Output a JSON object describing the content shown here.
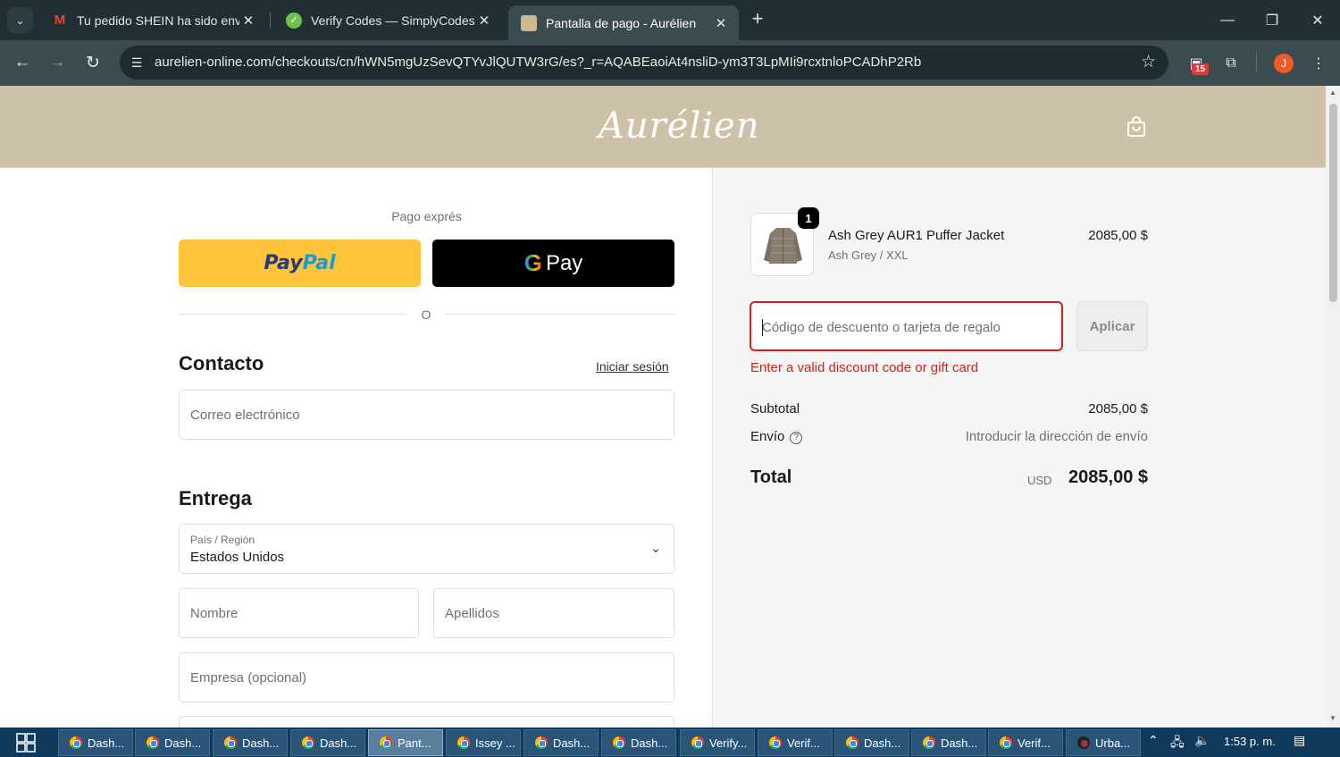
{
  "browser": {
    "tabs": [
      {
        "title": "Tu pedido SHEIN ha sido enviado",
        "icon": "gmail-icon"
      },
      {
        "title": "Verify Codes — SimplyCodes",
        "icon": "simplycodes-icon"
      },
      {
        "title": "Pantalla de pago - Aurélien",
        "icon": "aurelien-icon"
      }
    ],
    "url": "aurelien-online.com/checkouts/cn/hWN5mgUzSevQTYvJlQUTW3rG/es?_r=AQABEaoiAt4nsliD-ym3T3LpMIi9rcxtnloPCADhP2Rb",
    "extension_badge": "15",
    "profile_initial": "J"
  },
  "header": {
    "logo": "Aurélien"
  },
  "express": {
    "label": "Pago exprés",
    "paypal_a": "Pay",
    "paypal_b": "Pal",
    "gpay_g": "G",
    "gpay_text": "Pay",
    "divider": "O"
  },
  "contact": {
    "title": "Contacto",
    "login": "Iniciar sesión",
    "email_placeholder": "Correo electrónico"
  },
  "delivery": {
    "title": "Entrega",
    "country_label": "País / Región",
    "country_value": "Estados Unidos",
    "first_name": "Nombre",
    "last_name": "Apellidos",
    "company": "Empresa (opcional)"
  },
  "order": {
    "quantity": "1",
    "product_name": "Ash Grey AUR1 Puffer Jacket",
    "variant": "Ash Grey / XXL",
    "price": "2085,00 $",
    "discount_placeholder": "Código de descuento o tarjeta de regalo",
    "apply_label": "Aplicar",
    "error": "Enter a valid discount code or gift card",
    "subtotal_label": "Subtotal",
    "subtotal_value": "2085,00 $",
    "shipping_label": "Envío",
    "shipping_value": "Introducir la dirección de envío",
    "total_label": "Total",
    "total_currency": "USD",
    "total_value": "2085,00 $"
  },
  "taskbar": {
    "items": [
      "Dash...",
      "Dash...",
      "Dash...",
      "Dash...",
      "Pant...",
      "Issey ...",
      "Dash...",
      "Dash...",
      "Verify...",
      "Verif...",
      "Dash...",
      "Dash...",
      "Verif...",
      "Urba..."
    ],
    "time": "1:53 p. m."
  },
  "colors": {
    "header_bg": "#cdc1a8",
    "error": "#dd1d1d",
    "paypal": "#ffc439"
  }
}
